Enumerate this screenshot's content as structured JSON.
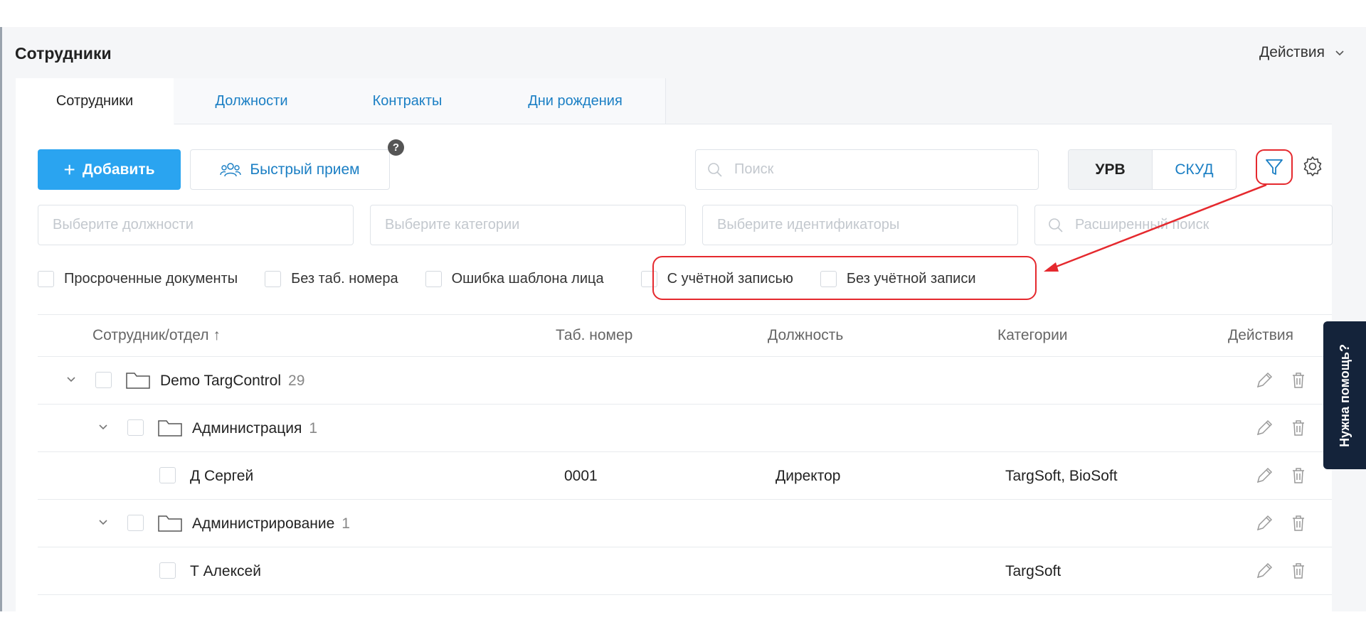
{
  "header": {
    "title": "Сотрудники",
    "actions_label": "Действия"
  },
  "tabs": [
    {
      "label": "Сотрудники",
      "active": true
    },
    {
      "label": "Должности",
      "active": false
    },
    {
      "label": "Контракты",
      "active": false
    },
    {
      "label": "Дни рождения",
      "active": false
    }
  ],
  "toolbar": {
    "add_label": "Добавить",
    "quick_label": "Быстрый прием",
    "help_mark": "?",
    "search_placeholder": "Поиск",
    "seg_urv": "УРВ",
    "seg_skud": "СКУД"
  },
  "filters": {
    "positions_placeholder": "Выберите должности",
    "categories_placeholder": "Выберите категории",
    "identifiers_placeholder": "Выберите идентификаторы",
    "advanced_placeholder": "Расширенный поиск"
  },
  "checkboxes": [
    {
      "label": "Просроченные документы"
    },
    {
      "label": "Без таб. номера"
    },
    {
      "label": "Ошибка шаблона лица"
    },
    {
      "label": "С учётной записью"
    },
    {
      "label": "Без учётной записи"
    }
  ],
  "table": {
    "columns": {
      "employee": "Сотрудник/отдел ↑",
      "tab_number": "Таб. номер",
      "position": "Должность",
      "categories": "Категории",
      "actions": "Действия"
    },
    "rows": [
      {
        "type": "folder",
        "level": 0,
        "name": "Demo TargControl",
        "count": "29",
        "tab_number": "",
        "position": "",
        "categories": ""
      },
      {
        "type": "folder",
        "level": 1,
        "name": "Администрация",
        "count": "1",
        "tab_number": "",
        "position": "",
        "categories": ""
      },
      {
        "type": "person",
        "level": 2,
        "name": "Д Сергей",
        "count": "",
        "tab_number": "0001",
        "position": "Директор",
        "categories": "TargSoft, BioSoft"
      },
      {
        "type": "folder",
        "level": 1,
        "name": "Администрирование",
        "count": "1",
        "tab_number": "",
        "position": "",
        "categories": ""
      },
      {
        "type": "person",
        "level": 2,
        "name": "Т Алексей",
        "count": "",
        "tab_number": "",
        "position": "",
        "categories": "TargSoft"
      }
    ]
  },
  "help_tab": {
    "label": "Нужна помощь?"
  },
  "colors": {
    "accent": "#2aa4f0",
    "link": "#1b7fc4",
    "highlight": "#e5292e",
    "help_bg": "#14233a"
  }
}
